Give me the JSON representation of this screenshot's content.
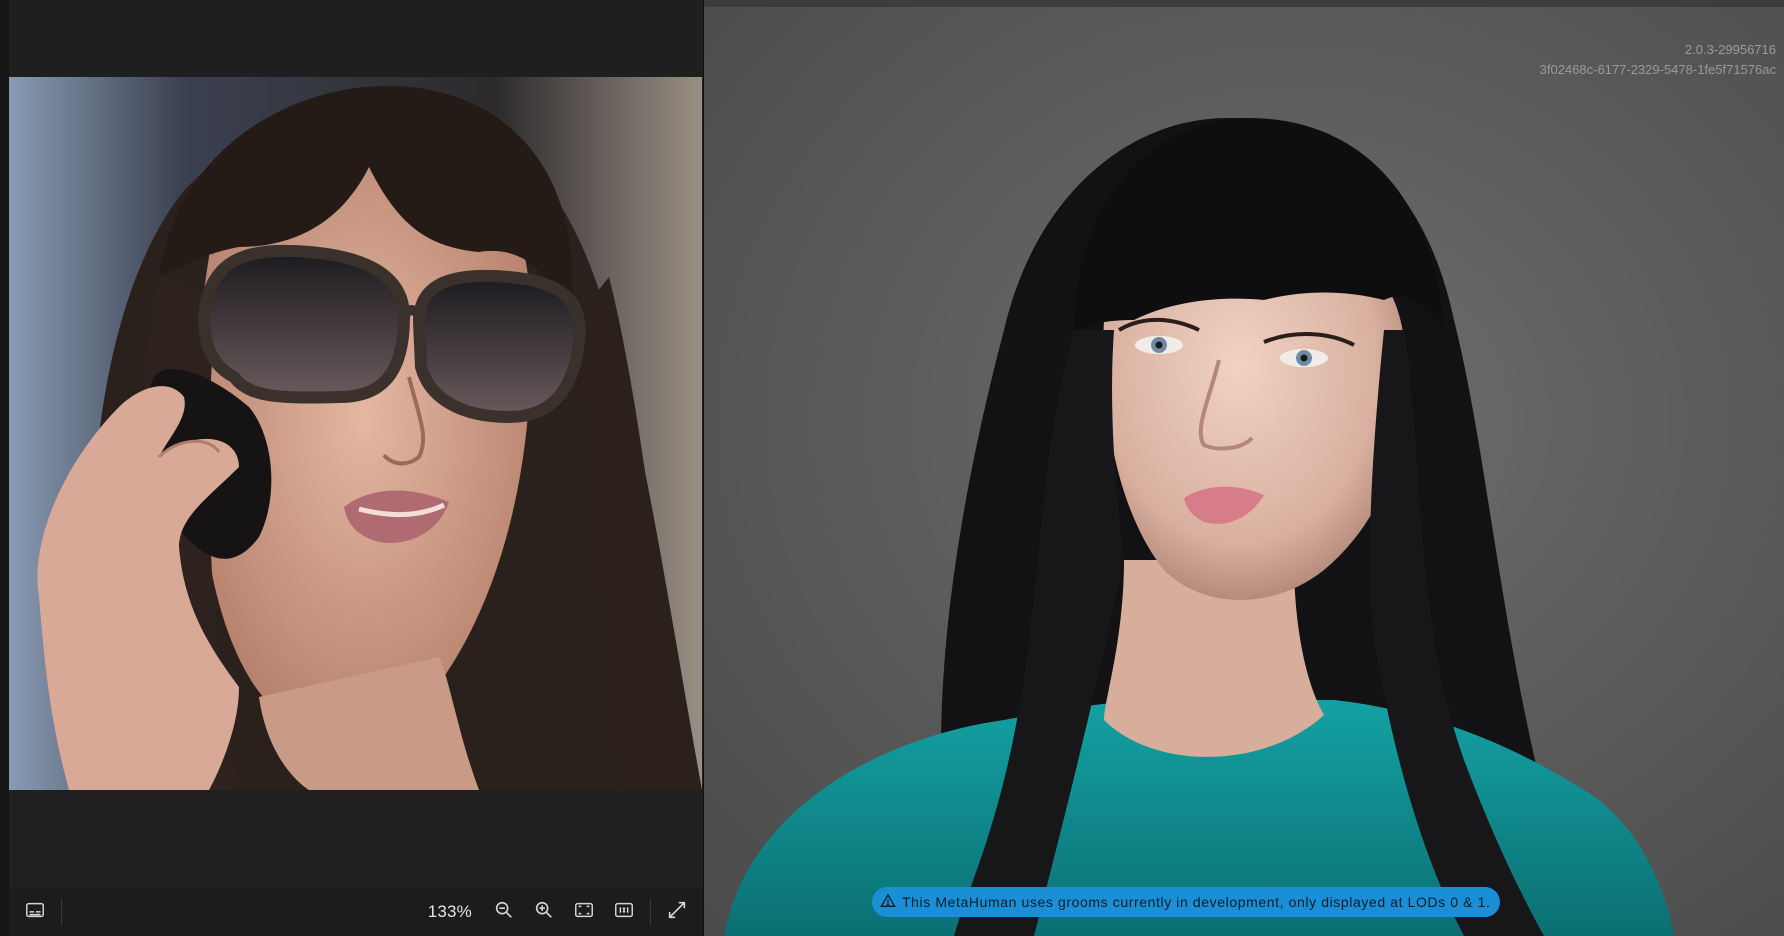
{
  "viewer": {
    "zoom_level": "133%",
    "toolbar": {
      "subtitles_icon": "subtitles-icon",
      "zoom_out_icon": "zoom-out-icon",
      "zoom_in_icon": "zoom-in-icon",
      "fit_screen_icon": "fit-screen-icon",
      "actual_size_icon": "one-to-one-icon",
      "fullscreen_icon": "expand-icon"
    }
  },
  "viewport": {
    "version": "2.0.3-29956716",
    "asset_id": "3f02468c-6177-2329-5478-1fe5f71576ac",
    "notice": "This MetaHuman uses grooms currently in development, only displayed at LODs 0 & 1.",
    "notice_icon": "warning-icon",
    "notice_color": "#1a8fd6"
  },
  "colors": {
    "panel_bg": "#202020",
    "toolbar_bg": "#1c1c1c",
    "viewport_bg": "#5d5d5d",
    "shirt": "#0f8a8c"
  }
}
